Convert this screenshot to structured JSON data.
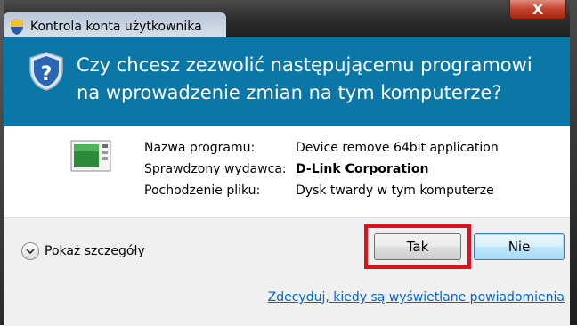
{
  "window": {
    "title": "Kontrola konta użytkownika",
    "close_symbol": "X"
  },
  "header": {
    "question": "Czy chcesz zezwolić następującemu programowi na wprowadzenie zmian na tym komputerze?",
    "background_color": "#0a77a6"
  },
  "program_info": {
    "rows": [
      {
        "label": "Nazwa programu:",
        "value": "Device remove 64bit application"
      },
      {
        "label": "Sprawdzony wydawca:",
        "value": "D-Link Corporation"
      },
      {
        "label": "Pochodzenie pliku:",
        "value": "Dysk twardy w tym komputerze"
      }
    ]
  },
  "footer": {
    "details_label": "Pokaż szczegóły",
    "yes_button": "Tak",
    "no_button": "Nie",
    "notification_link": "Zdecyduj, kiedy są wyświetlane powiadomienia",
    "highlight_color": "#e0101a"
  },
  "icons": {
    "title_icon": "uac-shield-icon",
    "header_icon": "uac-question-shield-icon",
    "program_icon": "program-window-icon",
    "details_icon": "chevron-down-icon"
  }
}
